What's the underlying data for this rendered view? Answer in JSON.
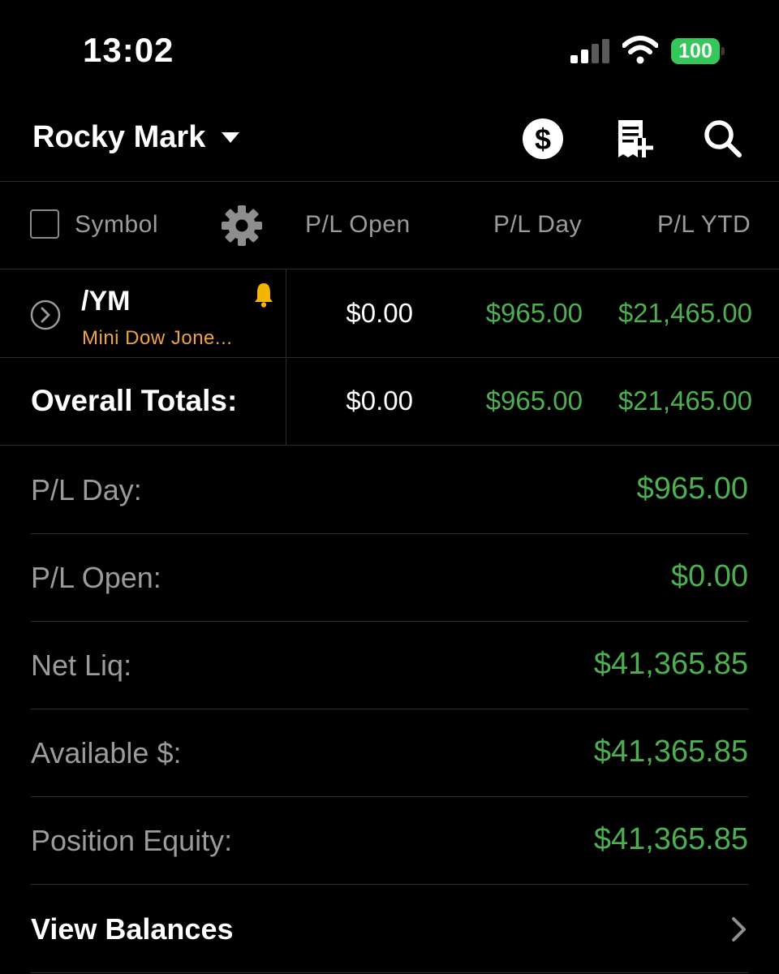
{
  "status_bar": {
    "time": "13:02",
    "battery": "100"
  },
  "header": {
    "account_name": "Rocky Mark",
    "icons": [
      "dollar-circle-icon",
      "receipt-add-icon",
      "search-icon"
    ]
  },
  "columns": {
    "symbol": "Symbol",
    "pl_open": "P/L Open",
    "pl_day": "P/L Day",
    "pl_ytd": "P/L YTD"
  },
  "positions": [
    {
      "symbol": "/YM",
      "description": "Mini Dow Jone...",
      "pl_open": "$0.00",
      "pl_day": "$965.00",
      "pl_ytd": "$21,465.00"
    }
  ],
  "totals": {
    "label": "Overall Totals:",
    "pl_open": "$0.00",
    "pl_day": "$965.00",
    "pl_ytd": "$21,465.00"
  },
  "summary": [
    {
      "label": "P/L Day:",
      "value": "$965.00"
    },
    {
      "label": "P/L Open:",
      "value": "$0.00"
    },
    {
      "label": "Net Liq:",
      "value": "$41,365.85"
    },
    {
      "label": "Available $:",
      "value": "$41,365.85"
    },
    {
      "label": "Position Equity:",
      "value": "$41,365.85"
    }
  ],
  "view_balances": "View Balances",
  "colors": {
    "positive": "#4caf50",
    "description": "#f0a33b",
    "battery": "#34c759",
    "muted": "#9b9b9b"
  }
}
